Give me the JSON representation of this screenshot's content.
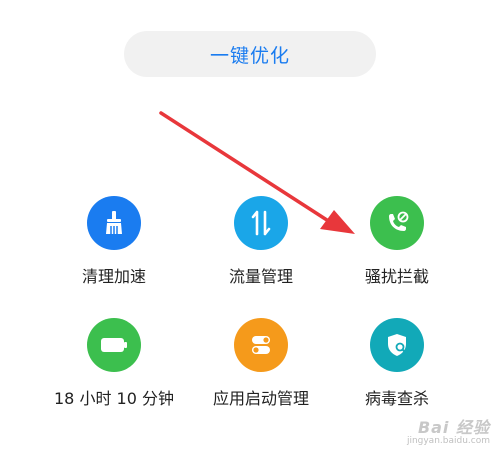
{
  "optimize": {
    "label": "一键优化"
  },
  "tiles": [
    {
      "label": "清理加速",
      "icon": "broom-icon",
      "color": "#1a7cf0"
    },
    {
      "label": "流量管理",
      "icon": "data-transfer-icon",
      "color": "#1aa6e8"
    },
    {
      "label": "骚扰拦截",
      "icon": "phone-block-icon",
      "color": "#3cbf4e"
    },
    {
      "label": "18 小时 10 分钟",
      "icon": "battery-icon",
      "color": "#3cbf4e"
    },
    {
      "label": "应用启动管理",
      "icon": "toggle-switch-icon",
      "color": "#f59a1b"
    },
    {
      "label": "病毒查杀",
      "icon": "shield-scan-icon",
      "color": "#12a9b8"
    }
  ],
  "annotation": {
    "arrow_color": "#e8373b"
  },
  "watermark": {
    "brand": "Bai 经验",
    "url": "jingyan.baidu.com"
  }
}
